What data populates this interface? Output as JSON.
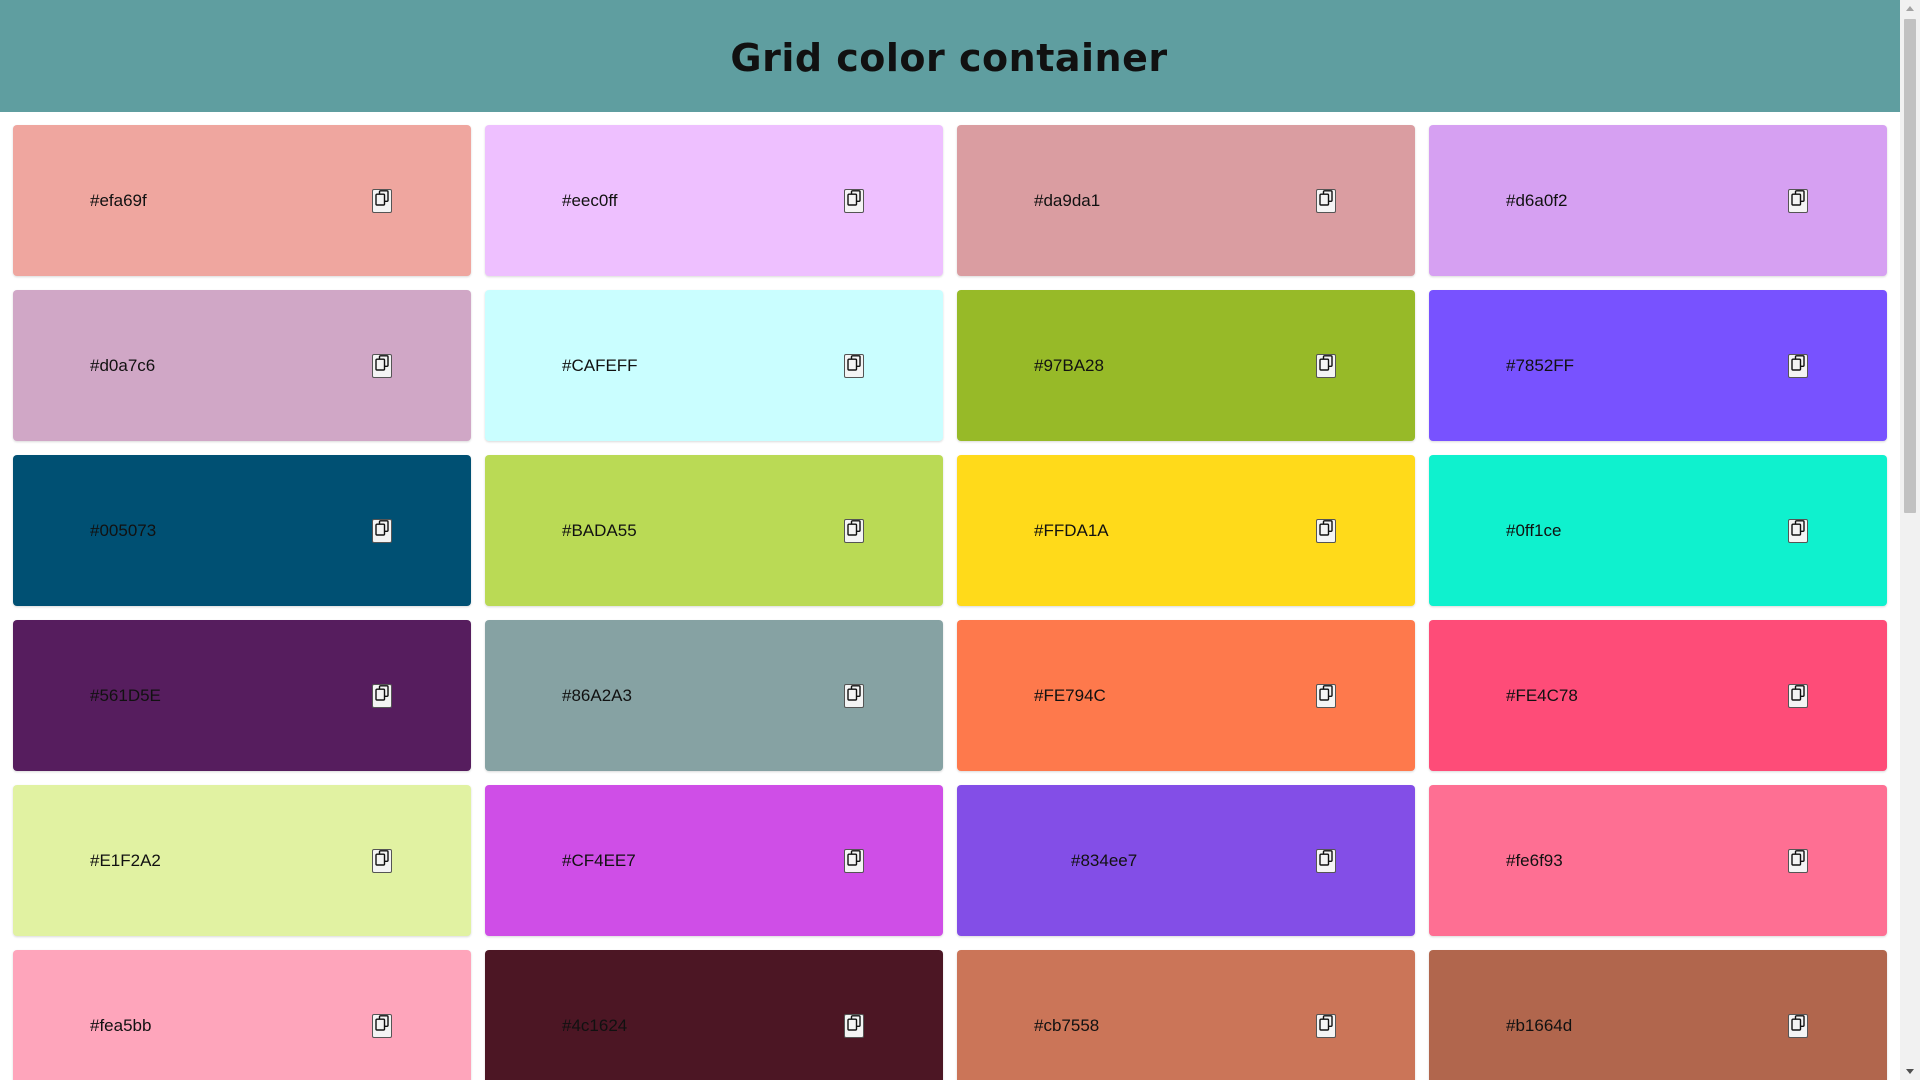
{
  "header": {
    "title": "Grid color container"
  },
  "colors": [
    {
      "label": "#efa69f",
      "bg": "#efa69f"
    },
    {
      "label": "#eec0ff",
      "bg": "#eec0ff"
    },
    {
      "label": "#da9da1",
      "bg": "#da9da1"
    },
    {
      "label": "#d6a0f2",
      "bg": "#d6a0f2"
    },
    {
      "label": "#d0a7c6",
      "bg": "#d0a7c6"
    },
    {
      "label": "#CAFEFF",
      "bg": "#CAFEFF"
    },
    {
      "label": "#97BA28",
      "bg": "#97BA28"
    },
    {
      "label": "#7852FF",
      "bg": "#7852FF"
    },
    {
      "label": "#005073",
      "bg": "#005073"
    },
    {
      "label": "#BADA55",
      "bg": "#BADA55"
    },
    {
      "label": "#FFDA1A",
      "bg": "#FFDA1A"
    },
    {
      "label": "#0ff1ce",
      "bg": "#0ff1ce"
    },
    {
      "label": "#561D5E",
      "bg": "#561D5E"
    },
    {
      "label": "#86A2A3",
      "bg": "#86A2A3"
    },
    {
      "label": "#FE794C",
      "bg": "#FE794C"
    },
    {
      "label": "#FE4C78",
      "bg": "#FE4C78"
    },
    {
      "label": "#E1F2A2",
      "bg": "#E1F2A2"
    },
    {
      "label": "#CF4EE7",
      "bg": "#CF4EE7"
    },
    {
      "label": "#834ee7",
      "bg": "#834ee7"
    },
    {
      "label": "#fe6f93",
      "bg": "#fe6f93"
    },
    {
      "label": "#fea5bb",
      "bg": "#fea5bb"
    },
    {
      "label": "#4c1624",
      "bg": "#4c1624"
    },
    {
      "label": "#cb7558",
      "bg": "#cb7558"
    },
    {
      "label": "#b1664d",
      "bg": "#b1664d"
    }
  ],
  "icons": {
    "copy": "copy-icon",
    "scroll_up": "chevron-up-icon",
    "scroll_down": "chevron-down-icon"
  }
}
